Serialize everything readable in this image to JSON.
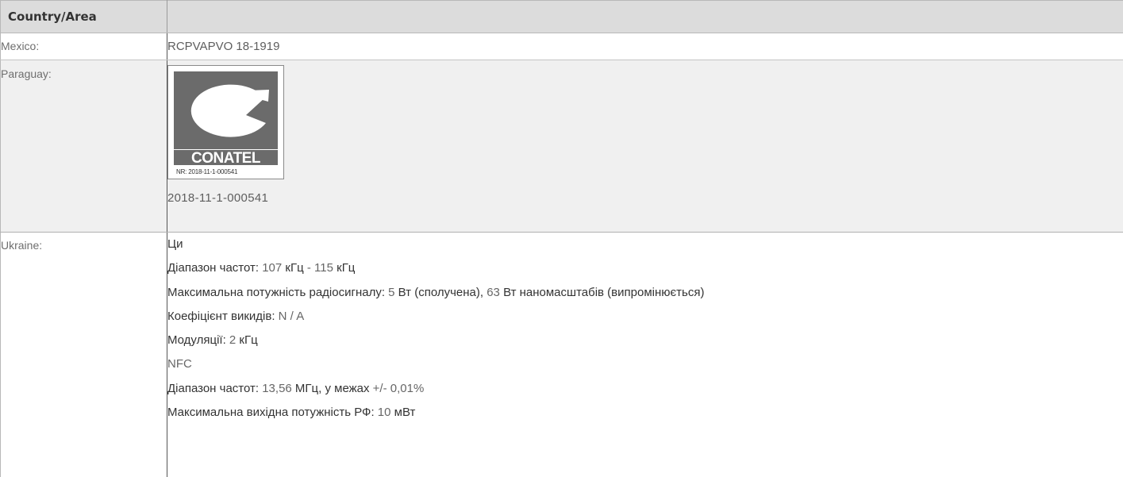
{
  "header": {
    "col1": "Country/Area",
    "col2": ""
  },
  "rows": {
    "mexico": {
      "label": "Mexico:",
      "value": "RCPVAPVO 18-1919"
    },
    "paraguay": {
      "label": "Paraguay:",
      "logo_text": "CONATEL",
      "logo_nr": "NR: 2018-11-1-000541",
      "number": "2018-11-1-000541"
    },
    "ukraine": {
      "label": "Ukraine:",
      "lines": [
        {
          "label": "Ци",
          "value": ""
        },
        {
          "label": "Діапазон частот:",
          "value": " 107 ",
          "label2": "кГц",
          "value2": " - 115 ",
          "label3": "кГц"
        },
        {
          "label": "Максимальна потужність радіосигналу:",
          "value": " 5 ",
          "label2": "Вт (сполучена),",
          "value2": " 63 ",
          "label3": "Вт наномасштабів (випромінюється)"
        },
        {
          "label": "Коефіцієнт викидів:",
          "value": " N / A"
        },
        {
          "label": "Модуляції:",
          "value": " 2 ",
          "label2": "кГц"
        },
        {
          "label": "",
          "value": "NFC"
        },
        {
          "label": "Діапазон частот:",
          "value": " 13,56 ",
          "label2": "МГц, у межах",
          "value2": " +/- 0,01%"
        },
        {
          "label": "Максимальна вихідна потужність РФ:",
          "value": " 10 ",
          "label2": "мВт"
        }
      ]
    }
  },
  "colors": {
    "header_bg": "#dcdcdc",
    "paraguay_bg": "#f0f0f0",
    "logo_gray": "#6b6b6b"
  }
}
